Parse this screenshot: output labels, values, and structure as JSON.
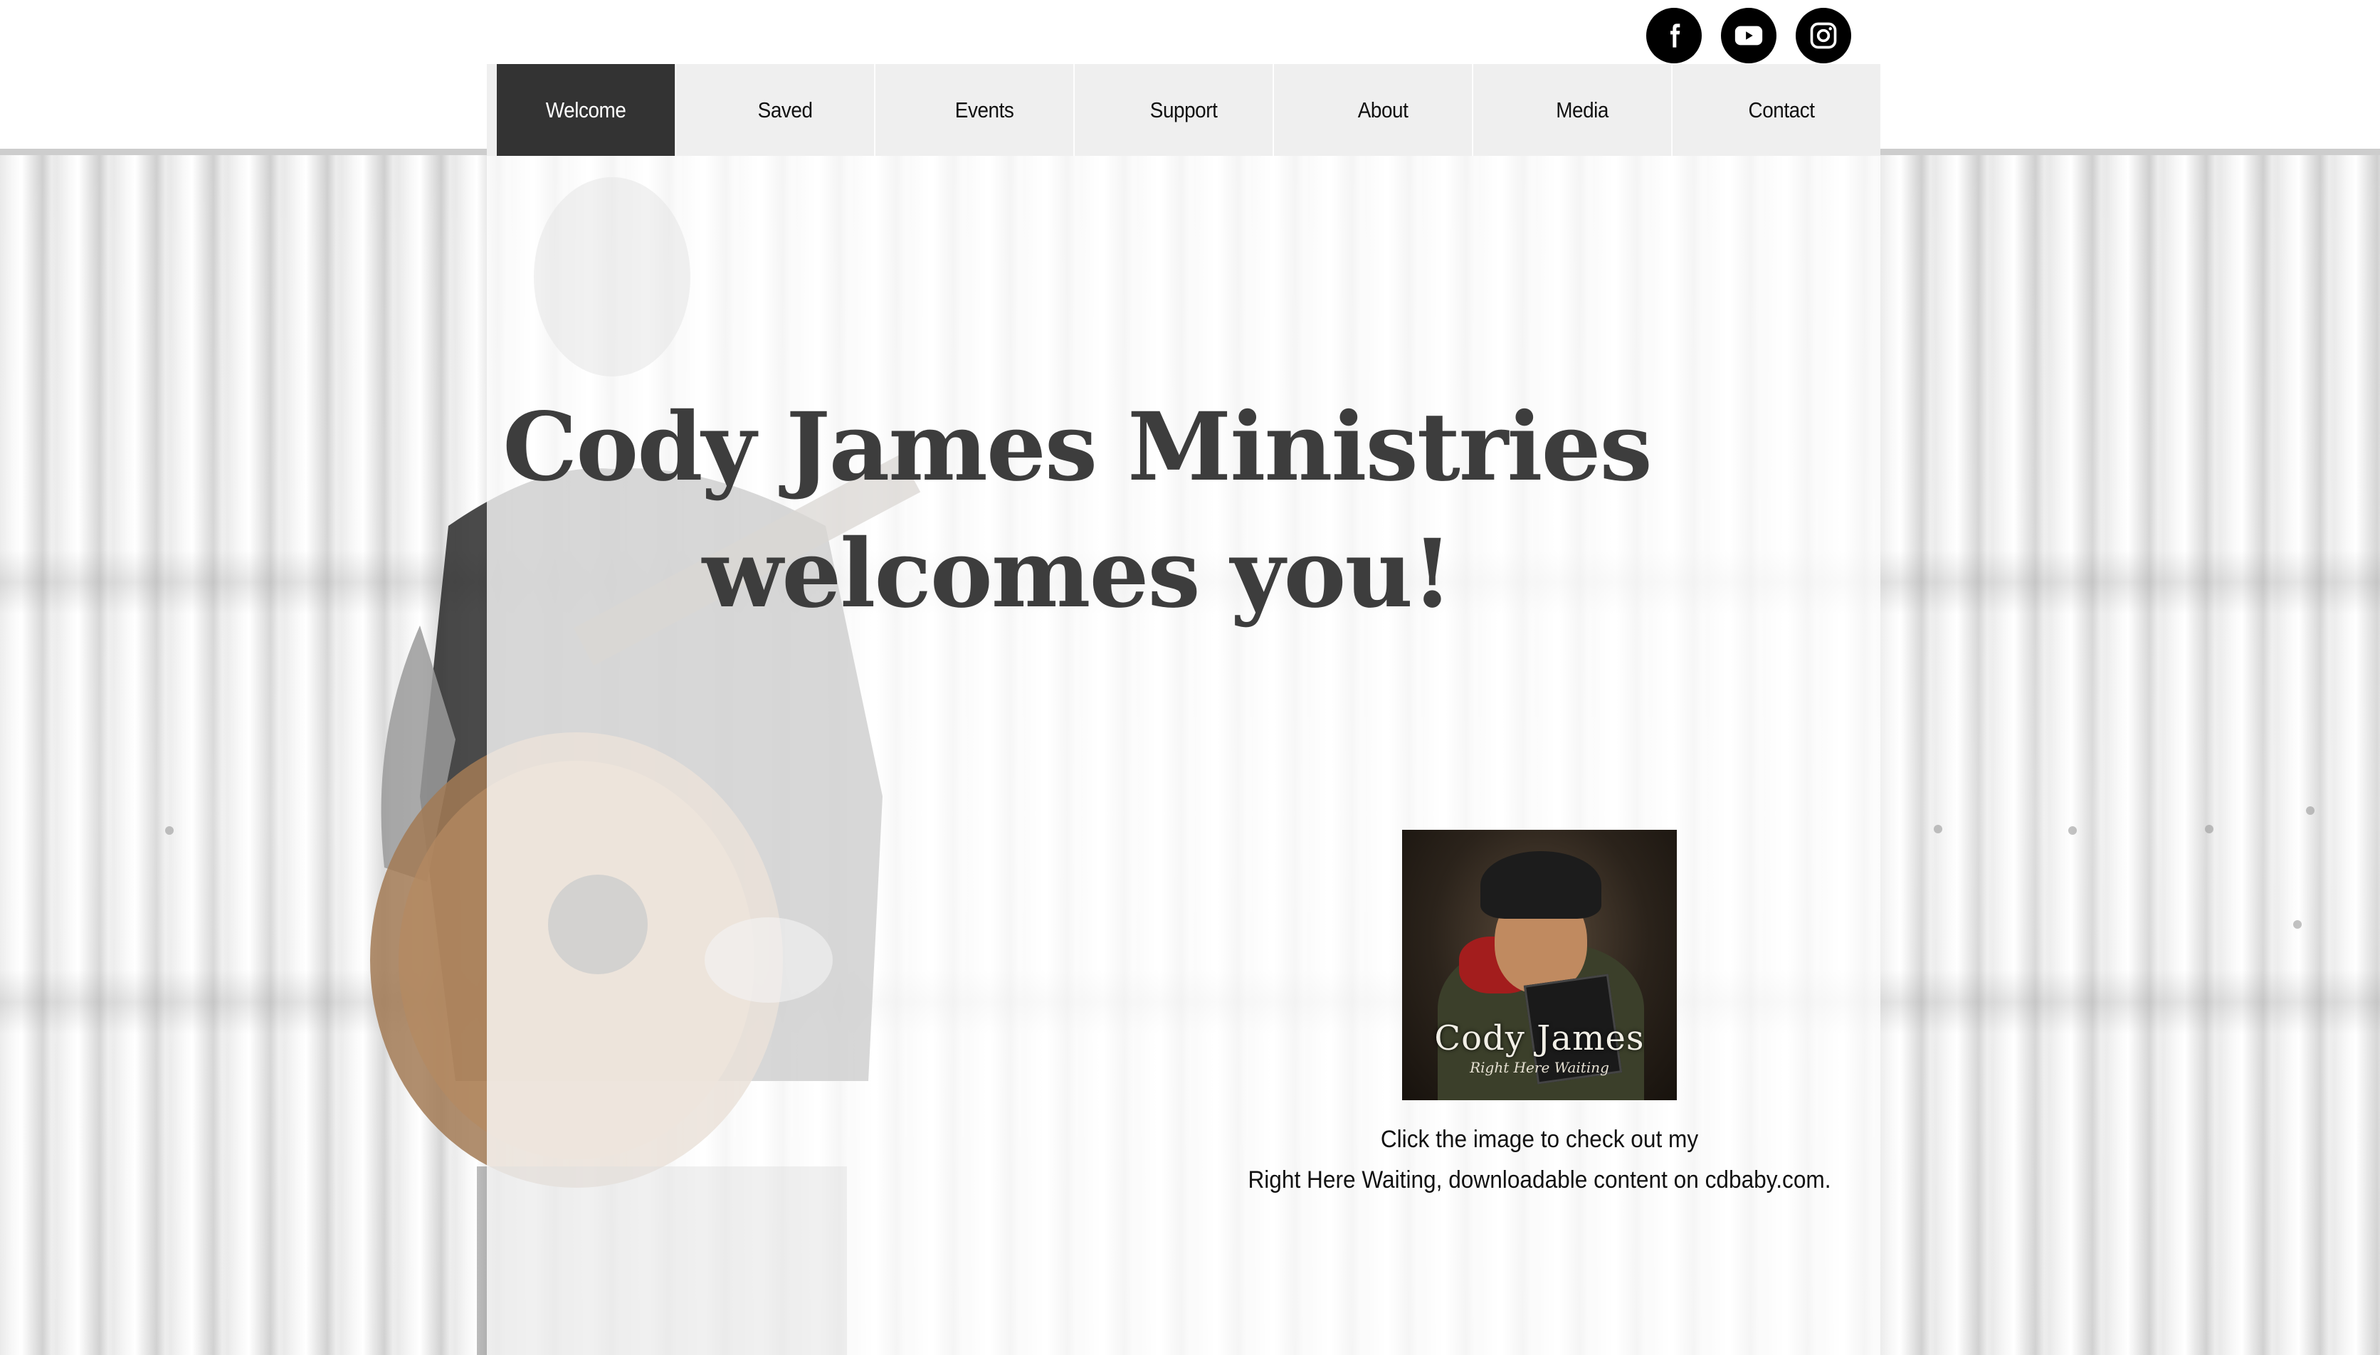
{
  "social": {
    "items": [
      {
        "name": "facebook",
        "icon": "facebook-icon"
      },
      {
        "name": "youtube",
        "icon": "youtube-icon"
      },
      {
        "name": "instagram",
        "icon": "instagram-icon"
      }
    ]
  },
  "nav": {
    "items": [
      {
        "label": "Welcome",
        "active": true
      },
      {
        "label": "Saved",
        "active": false
      },
      {
        "label": "Events",
        "active": false
      },
      {
        "label": "Support",
        "active": false
      },
      {
        "label": "About",
        "active": false
      },
      {
        "label": "Media",
        "active": false
      },
      {
        "label": "Contact",
        "active": false
      }
    ]
  },
  "hero": {
    "title_line1": "Cody James Ministries",
    "title_line2": "welcomes you!"
  },
  "album": {
    "title": "Cody James",
    "subtitle": "Right Here Waiting"
  },
  "caption": {
    "line1": "Click the image to check out my",
    "line2": "Right Here Waiting, downloadable content on cdbaby.com."
  },
  "colors": {
    "nav_active": "#333333",
    "nav_bg": "#efefef",
    "title_text": "#3d3d3d"
  }
}
